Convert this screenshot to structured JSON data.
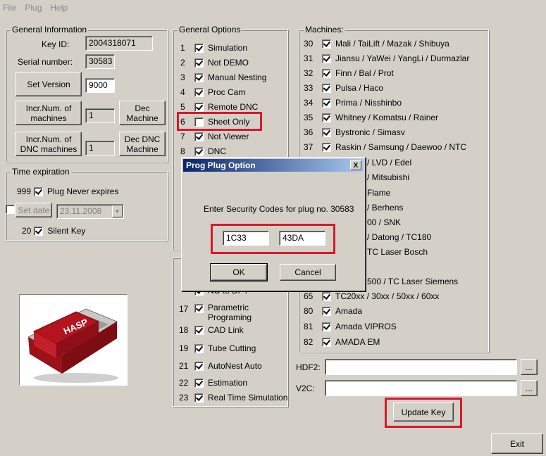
{
  "menu": [
    "File",
    "Plug",
    "Help"
  ],
  "general_info": {
    "title": "General Information",
    "key_id_label": "Key ID:",
    "key_id_value": "2004318071",
    "serial_label": "Serial number:",
    "serial_value": "30583",
    "set_version_label": "Set Version",
    "version_value": "9000",
    "incr_machines_label": "Incr.Num. of machines",
    "incr_machines_value": "1",
    "dec_machine_label": "Dec Machine",
    "incr_dnc_label": "Incr.Num. of DNC machines",
    "incr_dnc_value": "1",
    "dec_dnc_label": "Dec DNC Machine"
  },
  "time_expiration": {
    "title": "Time expiration",
    "never_num": "999",
    "never_label": "Plug Never expires",
    "set_date_label": "Set date",
    "date_value": "23.11.2008",
    "silent_num": "20",
    "silent_label": "Silent Key"
  },
  "general_options": {
    "title": "General Options",
    "items": [
      {
        "num": "1",
        "label": "Simulation",
        "checked": true
      },
      {
        "num": "2",
        "label": "Not DEMO",
        "checked": true
      },
      {
        "num": "3",
        "label": "Manual Nesting",
        "checked": true
      },
      {
        "num": "4",
        "label": "Proc Cam",
        "checked": true
      },
      {
        "num": "5",
        "label": "Remote DNC",
        "checked": true
      },
      {
        "num": "6",
        "label": "Sheet Only",
        "checked": false
      },
      {
        "num": "7",
        "label": "Not Viewer",
        "checked": true
      },
      {
        "num": "8",
        "label": "DNC",
        "checked": true
      }
    ]
  },
  "lower_options": {
    "first_partial": "NC to DPT",
    "items": [
      {
        "num": "17",
        "label": "Parametric Programing",
        "checked": true
      },
      {
        "num": "18",
        "label": "CAD Link",
        "checked": true
      },
      {
        "num": "19",
        "label": "Tube Cutting",
        "checked": true
      },
      {
        "num": "21",
        "label": "AutoNest Auto",
        "checked": true
      },
      {
        "num": "22",
        "label": "Estimation",
        "checked": true
      },
      {
        "num": "23",
        "label": "Real Time Simulation",
        "checked": true
      }
    ]
  },
  "machines": {
    "title": "Machines:",
    "items": [
      {
        "num": "30",
        "label": "Mali / TaiLift / Mazak / Shibuya"
      },
      {
        "num": "31",
        "label": "Jiansu / YaWei / YangLi / Durmazlar"
      },
      {
        "num": "32",
        "label": "Finn / Bal / Prot"
      },
      {
        "num": "33",
        "label": "Pulsa / Haco"
      },
      {
        "num": "34",
        "label": "Prima / Nisshinbo"
      },
      {
        "num": "35",
        "label": "Whitney / Komatsu / Rainer"
      },
      {
        "num": "36",
        "label": "Bystronic / Simasv"
      },
      {
        "num": "37",
        "label": "Raskin / Samsung / Daewoo / NTC"
      }
    ],
    "partials": [
      "/ LVD / Edel",
      "/ Mitsubishi",
      "Flame",
      "/ Berhens",
      "00 / SNK",
      "/ Datong / TC180",
      "TC Laser Bosch",
      "500 / TC Laser Siemens"
    ],
    "items_lower": [
      {
        "num": "65",
        "label": "TC20xx / 30xx / 50xx / 60xx"
      },
      {
        "num": "80",
        "label": "Amada"
      },
      {
        "num": "81",
        "label": "Amada VIPROS"
      },
      {
        "num": "82",
        "label": "AMADA EM"
      }
    ]
  },
  "hdf2_label": "HDF2:",
  "v2c_label": "V2C:",
  "browse_label": "...",
  "update_key_label": "Update Key",
  "exit_label": "Exit",
  "hasp_label": "HASP",
  "dialog": {
    "title": "Prog Plug Option",
    "close": "X",
    "message": "Enter Security Codes for plug no. 30583",
    "code1": "1C33",
    "code2": "43DA",
    "ok_label": "OK",
    "cancel_label": "Cancel"
  },
  "colors": {
    "window_bg": "#d4d0c8",
    "highlight_red": "#d9182a",
    "title_bar": "#0a246a",
    "hasp_red": "#b3141e"
  }
}
